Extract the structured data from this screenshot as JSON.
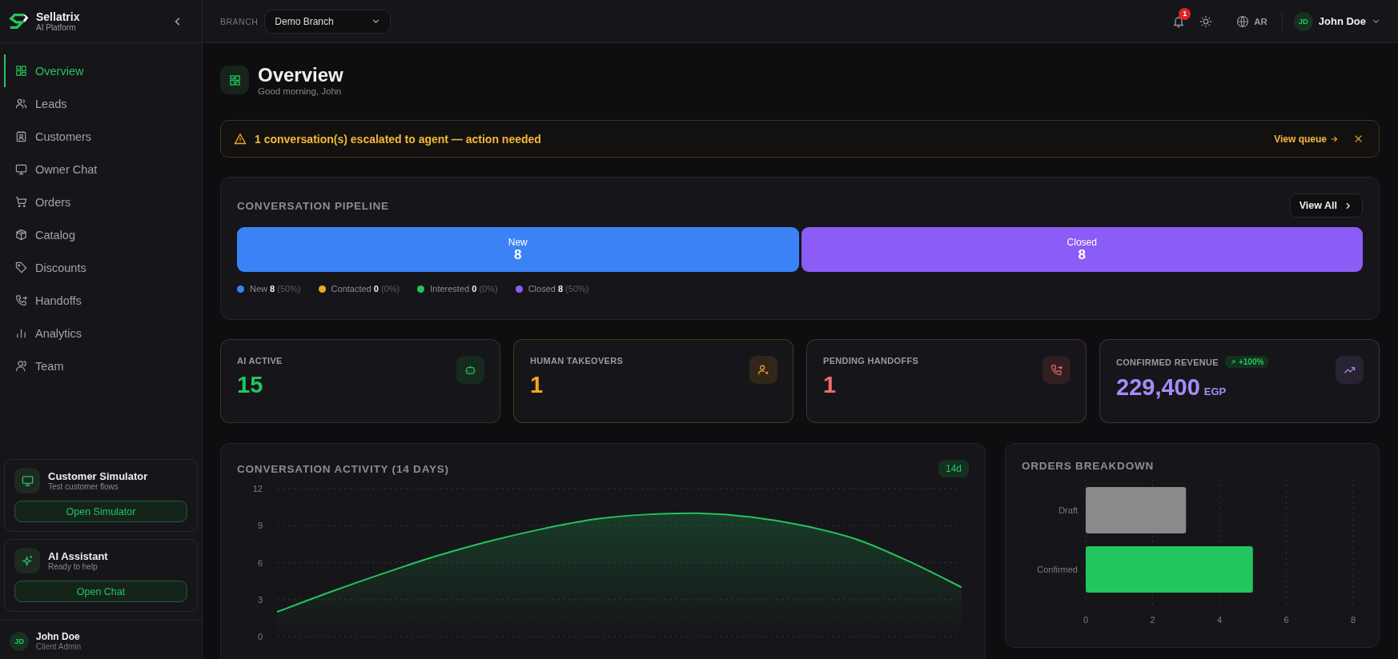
{
  "sidebar": {
    "brand": {
      "name": "Sellatrix",
      "subtitle": "AI Platform"
    },
    "nav": [
      {
        "label": "Overview",
        "selected": true
      },
      {
        "label": "Leads",
        "selected": false
      },
      {
        "label": "Customers",
        "selected": false
      },
      {
        "label": "Owner Chat",
        "selected": false
      },
      {
        "label": "Orders",
        "selected": false
      },
      {
        "label": "Catalog",
        "selected": false
      },
      {
        "label": "Discounts",
        "selected": false
      },
      {
        "label": "Handoffs",
        "selected": false
      },
      {
        "label": "Analytics",
        "selected": false
      },
      {
        "label": "Team",
        "selected": false
      }
    ],
    "promo_cards": [
      {
        "kind": "simulator",
        "title": "Customer Simulator",
        "subtitle": "Test customer flows",
        "button": "Open Simulator"
      },
      {
        "kind": "assistant",
        "title": "AI Assistant",
        "subtitle": "Ready to help",
        "button": "Open Chat"
      }
    ],
    "user": {
      "initials": "JD",
      "name": "John Doe",
      "role": "Client Admin"
    }
  },
  "header": {
    "branch_label": "BRANCH",
    "branch_select": "Demo Branch",
    "notification_count": "1",
    "language": "AR",
    "user": {
      "initials": "JD",
      "name": "John Doe"
    }
  },
  "page": {
    "title": "Overview",
    "subtitle": "Good morning, John"
  },
  "alert": {
    "message": "1 conversation(s) escalated to agent — action needed",
    "action": "View queue"
  },
  "pipeline": {
    "title": "CONVERSATION PIPELINE",
    "view_all": "View All",
    "segments": [
      {
        "label": "New",
        "value": "8",
        "color": "#3b82f6"
      },
      {
        "label": "Closed",
        "value": "8",
        "color": "#8b5cf6"
      }
    ],
    "legend": [
      {
        "label": "New",
        "count": "8",
        "percent": "(50%)",
        "color": "#3b82f6"
      },
      {
        "label": "Contacted",
        "count": "0",
        "percent": "(0%)",
        "color": "#f5a524"
      },
      {
        "label": "Interested",
        "count": "0",
        "percent": "(0%)",
        "color": "#22c55e"
      },
      {
        "label": "Closed",
        "count": "8",
        "percent": "(50%)",
        "color": "#8b5cf6"
      }
    ]
  },
  "stats": [
    {
      "kind": "ai",
      "label": "AI ACTIVE",
      "value": "15",
      "color": "#22c55e"
    },
    {
      "kind": "human",
      "label": "HUMAN TAKEOVERS",
      "value": "1",
      "color": "#f5a524"
    },
    {
      "kind": "handoff",
      "label": "PENDING HANDOFFS",
      "value": "1",
      "color": "#f06a6a"
    },
    {
      "kind": "revenue",
      "label": "CONFIRMED REVENUE",
      "value": "229,400",
      "unit": "EGP",
      "badge": "+100%",
      "color": "#a78bfa"
    }
  ],
  "activity": {
    "title": "CONVERSATION ACTIVITY (14 DAYS)",
    "badge": "14d",
    "chart_data": {
      "type": "area",
      "grid": true,
      "ylim": [
        0,
        12
      ],
      "yticks": [
        0,
        3,
        6,
        9,
        12
      ],
      "series": [
        {
          "color": "#22c55e",
          "values": [
            2,
            3.6,
            5.1,
            6.5,
            7.7,
            8.7,
            9.5,
            9.9,
            10,
            9.7,
            9.0,
            7.9,
            6.1,
            4
          ]
        }
      ]
    }
  },
  "orders": {
    "title": "ORDERS BREAKDOWN",
    "chart_data": {
      "type": "bar",
      "orientation": "horizontal",
      "grid": true,
      "categories": [
        "Draft",
        "Confirmed"
      ],
      "xlim": [
        0,
        8
      ],
      "xticks": [
        0,
        2,
        4,
        6,
        8
      ],
      "values": [
        3,
        5
      ],
      "colors": [
        "#8a8a8a",
        "#22c55e"
      ]
    }
  }
}
